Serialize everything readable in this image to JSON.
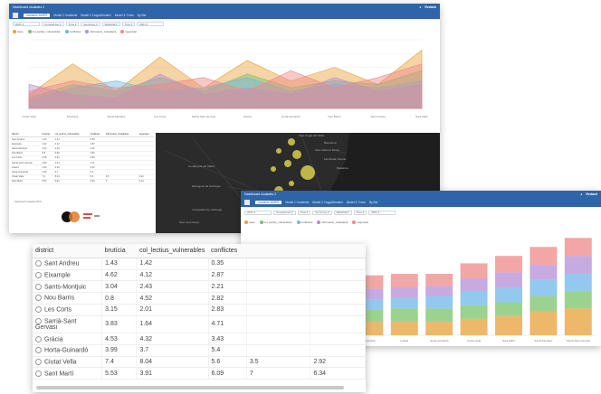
{
  "colors": {
    "titlebar": "#2f64a8",
    "series": [
      "#e8a03a",
      "#7ac36a",
      "#6fb7e8",
      "#b48ed6",
      "#ee8888"
    ]
  },
  "back_window": {
    "title": "Dashboard ciudades 2",
    "user": "Redash",
    "tabs": [
      "Incidents BARRI",
      "Model 1: Incidents",
      "Model 2: Dogs&Scratch",
      "Model 3: Trees",
      "By Bar"
    ],
    "filters": [
      "2021",
      "Comparison",
      "Time",
      "Summary",
      "Waterfall",
      "Tree",
      "2021"
    ],
    "legend": [
      "trees",
      "col_lectius_vulnerables",
      "conflictes",
      "informacio_ciutadania",
      "seguretat"
    ],
    "x_labels": [
      "Ciutat Vella",
      "Eixample",
      "Sants-Montjuïc",
      "Les Corts",
      "Sarrià-Sant Gervasi",
      "Gràcia",
      "Horta-Guinardó",
      "Nou Barris",
      "Sant Andreu",
      "Sant Martí"
    ],
    "map_labels": [
      "Barcelona",
      "Sant Cugat del Vallès",
      "Montcada i Reixac",
      "Badalona",
      "Cerdanyola del Vallès",
      "L'Hospitalet de Llobregat",
      "Esplugues de Llobregat",
      "Sant Joan Despí",
      "Sant Adrià de Besòs"
    ],
    "mini_table_headers": [
      "district",
      "brutícia",
      "col_lectius_vulnerables",
      "conflictes",
      "informació_ciutadania",
      "seguretat"
    ]
  },
  "front_window": {
    "title": "Dashboard ciudades 2",
    "user": "Redash",
    "tabs": [
      "Incidents BARRI",
      "Model 1: Incidents",
      "Model 2: Dogs&Scratch",
      "Model 3: Trees",
      "By Bar"
    ],
    "filters": [
      "2021",
      "Comparison",
      "Time",
      "Summary",
      "Waterfall",
      "Tree",
      "2021"
    ],
    "legend": [
      "trees",
      "col_lectius_vulnerables",
      "conflictes",
      "informacio_ciutadania",
      "seguretat"
    ],
    "x_labels": [
      "Nou Barris",
      "Les Corts",
      "Sant Andreu",
      "Eixample",
      "Gràcia",
      "Horta-Guinardó",
      "Ciutat Vella",
      "Sant Martí",
      "Sants-Montjuïc",
      "Sarrià-Sant Gervasi"
    ]
  },
  "table": {
    "headers": [
      "district",
      "brutícia",
      "col_lectius_vulnerables",
      "conflictes"
    ],
    "rows": [
      {
        "district": "Sant Andreu",
        "bruticia": "1.43",
        "col": "1.42",
        "conf": "0.35",
        "extra1": "",
        "extra2": ""
      },
      {
        "district": "Eixample",
        "bruticia": "4.62",
        "col": "4.12",
        "conf": "2.87",
        "extra1": "",
        "extra2": ""
      },
      {
        "district": "Sants-Montjuic",
        "bruticia": "3.04",
        "col": "2.43",
        "conf": "2.21",
        "extra1": "",
        "extra2": ""
      },
      {
        "district": "Nou Barris",
        "bruticia": "0.8",
        "col": "4.52",
        "conf": "2.82",
        "extra1": "",
        "extra2": ""
      },
      {
        "district": "Les Corts",
        "bruticia": "3.15",
        "col": "2.01",
        "conf": "2.83",
        "extra1": "",
        "extra2": ""
      },
      {
        "district": "Sarrià-Sant Gervasi",
        "bruticia": "3.83",
        "col": "1.64",
        "conf": "4.71",
        "extra1": "",
        "extra2": ""
      },
      {
        "district": "Gràcia",
        "bruticia": "4.53",
        "col": "4.32",
        "conf": "3.43",
        "extra1": "",
        "extra2": ""
      },
      {
        "district": "Horta-Guinardó",
        "bruticia": "3.99",
        "col": "3.7",
        "conf": "5.4",
        "extra1": "",
        "extra2": ""
      },
      {
        "district": "Ciutat Vella",
        "bruticia": "7.4",
        "col": "8.04",
        "conf": "5.6",
        "extra1": "3.5",
        "extra2": "2.92"
      },
      {
        "district": "Sant Martí",
        "bruticia": "5.53",
        "col": "3.91",
        "conf": "6.09",
        "extra1": "7",
        "extra2": "6.34"
      }
    ]
  },
  "chart_data": [
    {
      "type": "area",
      "categories": [
        "Ciutat Vella",
        "Eixample",
        "Sants-Montjuïc",
        "Les Corts",
        "Sarrià-Sant Gervasi",
        "Gràcia",
        "Horta-Guinardó",
        "Nou Barris",
        "Sant Andreu",
        "Sant Martí"
      ],
      "series": [
        {
          "name": "trees",
          "values": [
            2.0,
            6.5,
            2.5,
            7.5,
            3.0,
            7.0,
            4.0,
            6.0,
            3.5,
            8.5
          ]
        },
        {
          "name": "col_lectius_vulnerables",
          "values": [
            1.5,
            3.5,
            2.5,
            4.5,
            2.5,
            5.0,
            3.0,
            4.0,
            3.5,
            5.5
          ]
        },
        {
          "name": "conflictes",
          "values": [
            1.0,
            3.0,
            4.0,
            2.5,
            3.0,
            4.5,
            2.5,
            3.5,
            3.0,
            4.0
          ]
        },
        {
          "name": "informacio_ciutadania",
          "values": [
            3.5,
            2.0,
            1.5,
            5.0,
            2.0,
            3.0,
            2.0,
            4.5,
            2.5,
            3.5
          ]
        },
        {
          "name": "seguretat",
          "values": [
            2.5,
            4.0,
            3.0,
            3.5,
            4.5,
            2.5,
            5.5,
            3.0,
            4.5,
            6.5
          ]
        }
      ],
      "ylim": [
        0,
        10
      ]
    },
    {
      "type": "bar",
      "stacked": true,
      "categories": [
        "Nou Barris",
        "Les Corts",
        "Sant Andreu",
        "Eixample",
        "Gràcia",
        "Horta-Guinardó",
        "Ciutat Vella",
        "Sant Martí",
        "Sants-Montjuïc",
        "Sarrià-Sant Gervasi"
      ],
      "series": [
        {
          "name": "trees",
          "values": [
            0.8,
            1.6,
            1.4,
            1.8,
            1.8,
            1.8,
            2.2,
            2.6,
            3.2,
            3.6
          ]
        },
        {
          "name": "col_lectius_vulnerables",
          "values": [
            1.6,
            1.4,
            1.4,
            1.6,
            1.8,
            1.8,
            1.8,
            1.8,
            2.0,
            2.2
          ]
        },
        {
          "name": "conflictes",
          "values": [
            1.2,
            1.2,
            1.2,
            1.4,
            1.4,
            1.6,
            1.8,
            2.0,
            2.2,
            2.4
          ]
        },
        {
          "name": "informacio_ciutadania",
          "values": [
            1.0,
            1.2,
            1.4,
            1.4,
            1.4,
            1.4,
            1.8,
            2.0,
            2.0,
            2.4
          ]
        },
        {
          "name": "seguretat",
          "values": [
            0.8,
            1.2,
            1.6,
            1.8,
            1.8,
            1.6,
            2.0,
            2.2,
            2.4,
            2.4
          ]
        }
      ],
      "ylim": [
        0,
        14
      ]
    }
  ]
}
